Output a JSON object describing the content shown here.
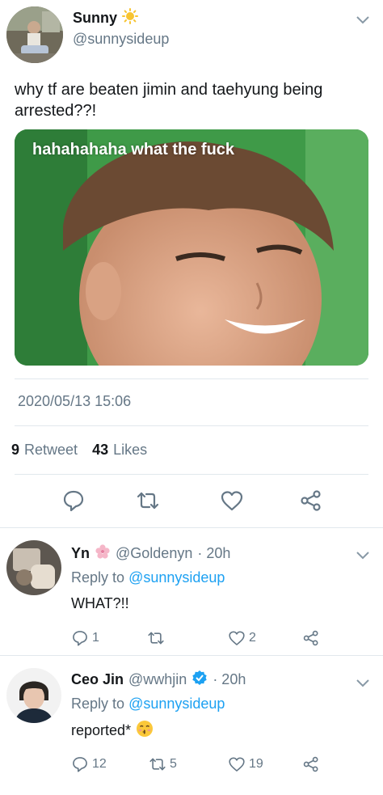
{
  "tweet": {
    "author_name": "Sunny",
    "author_handle": "@sunnysideup",
    "text": "why tf are beaten jimin and taehyung being arrested??!",
    "media_caption": "hahahahaha what the fuck",
    "timestamp": "2020/05/13 15:06",
    "retweet_count": "9",
    "retweet_label": "Retweet",
    "like_count": "43",
    "like_label": "Likes",
    "name_emoji_icon": "sun-icon"
  },
  "replies": [
    {
      "name": "Yn",
      "name_emoji_icon": "cherry-blossom-icon",
      "handle": "@Goldenyn",
      "time": "· 20h",
      "reply_to_label": "Reply to",
      "reply_to_handle": "@sunnysideup",
      "text": "WHAT?!!",
      "reply_count": "1",
      "retweet_count": "",
      "like_count": "2"
    },
    {
      "name": "Ceo Jin",
      "handle": "@wwhjin",
      "verified_icon": "verified-badge-icon",
      "time": "· 20h",
      "reply_to_label": "Reply to",
      "reply_to_handle": "@sunnysideup",
      "text": "reported*",
      "text_emoji_icon": "kissing-face-icon",
      "reply_count": "12",
      "retweet_count": "5",
      "like_count": "19"
    }
  ],
  "colors": {
    "link": "#1da1f2",
    "secondary_text": "#657786",
    "primary_text": "#14171a",
    "divider": "#e1e8ed"
  }
}
